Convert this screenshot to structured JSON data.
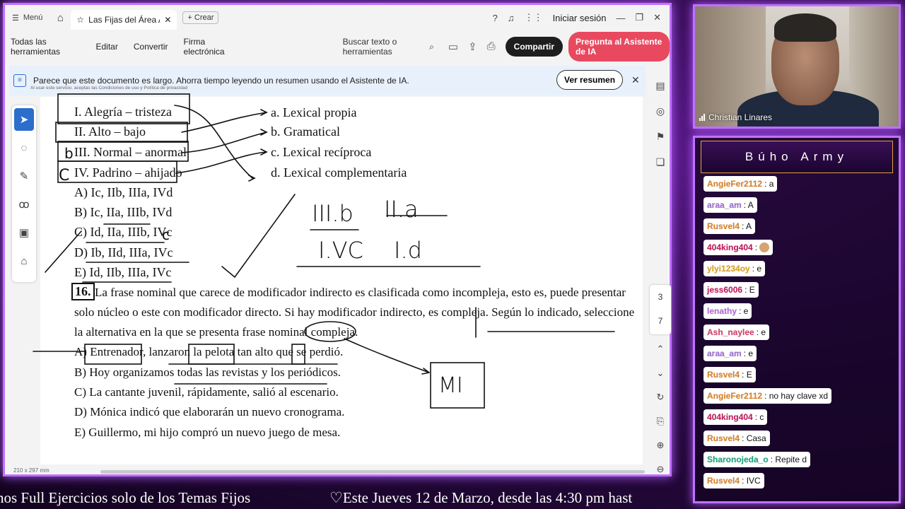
{
  "titlebar": {
    "menu_label": "Menú",
    "tab_title": "Las Fijas del Área A ...",
    "new_tab_label": "Crear",
    "login_label": "Iniciar sesión"
  },
  "toolbar": {
    "items": [
      "Todas las herramientas",
      "Editar",
      "Convertir",
      "Firma electrónica"
    ],
    "search_label": "Buscar texto o herramientas",
    "share_label": "Compartir",
    "ai_label": "Pregunta al Asistente de IA"
  },
  "banner": {
    "text": "Parece que este documento es largo. Ahorra tiempo leyendo un resumen usando el Asistente de IA.",
    "small_text": "Al usar este servicio, aceptas las Condiciones de uso y Política de privacidad",
    "button_label": "Ver resumen"
  },
  "document": {
    "pairs": [
      "I. Alegría – tristeza",
      "II. Alto – bajo",
      "III. Normal – anormal",
      "IV. Padrino – ahijado"
    ],
    "types": [
      "a. Lexical propia",
      "b. Gramatical",
      "c. Lexical recíproca",
      "d. Lexical complementaria"
    ],
    "options15": [
      "A) Ic, IIb, IIIa, IVd",
      "B) Ic, IIa, IIIb, IVd",
      "C) Id, IIa, IIIb, IVc",
      "D) Ib, IId, IIIa, IVc",
      "E) Id, IIb, IIIa, IVc"
    ],
    "q16_number": "16.",
    "q16_lines": [
      "La frase nominal que carece de modificador indirecto es clasificada como incompleja, esto es, puede presentar",
      "solo núcleo o este con modificador directo. Si hay modificador indirecto, es compleja. Según lo indicado, seleccione",
      "la alternativa en la que se presenta frase nominal compleja."
    ],
    "options16": [
      "A) Entrenador, lanzaron la pelota tan alto que se perdió.",
      "B) Hoy organizamos todas las revistas y los periódicos.",
      "C) La cantante juvenil, rápidamente, salió al escenario.",
      "D) Mónica indicó que elaborarán un nuevo cronograma.",
      "E) Guillermo, mi hijo compró un nuevo juego de mesa."
    ],
    "handwriting": {
      "row1_left": "III.b",
      "row1_right": "II.a",
      "row2_left": "I.VC",
      "row2_right": "I.d",
      "box_label": "MI",
      "letter_b": "b",
      "letter_c": "C",
      "letter_c2": "c"
    }
  },
  "page_size_label": "210 x 297 mm",
  "page_numbers": [
    "3",
    "7"
  ],
  "webcam": {
    "name": "Christian Linares"
  },
  "chat": {
    "title": "Búho Army",
    "messages": [
      {
        "user": "AngieFer2112",
        "text": ": a",
        "color": "#d9822b"
      },
      {
        "user": "araa_am",
        "text": ": A",
        "color": "#9b6bd1"
      },
      {
        "user": "Rusvel4",
        "text": ": A",
        "color": "#d9822b"
      },
      {
        "user": "404king404",
        "text": ":",
        "color": "#c2185b",
        "emoji": true
      },
      {
        "user": "ylyi1234oy",
        "text": ": e",
        "color": "#e0a21c"
      },
      {
        "user": "jess6006",
        "text": ": E",
        "color": "#c2185b"
      },
      {
        "user": "lenathy",
        "text": ": e",
        "color": "#b36bd6"
      },
      {
        "user": "Ash_naylee",
        "text": ": e",
        "color": "#d43f6a"
      },
      {
        "user": "araa_am",
        "text": ": e",
        "color": "#9b6bd1"
      },
      {
        "user": "Rusvel4",
        "text": ": E",
        "color": "#d9822b"
      },
      {
        "user": "AngieFer2112",
        "text": ": no hay clave xd",
        "color": "#d9822b"
      },
      {
        "user": "404king404",
        "text": ": c",
        "color": "#c2185b"
      },
      {
        "user": "Rusvel4",
        "text": ": Casa",
        "color": "#d9822b"
      },
      {
        "user": "Sharonojeda_o",
        "text": ": Repite d",
        "color": "#1aa37a"
      },
      {
        "user": "Rusvel4",
        "text": ": IVC",
        "color": "#d9822b"
      }
    ]
  },
  "ticker": {
    "left": "nos Full Ejercicios solo de los Temas Fijos",
    "right": "♡Este Jueves 12 de Marzo, desde las 4:30 pm hast"
  }
}
